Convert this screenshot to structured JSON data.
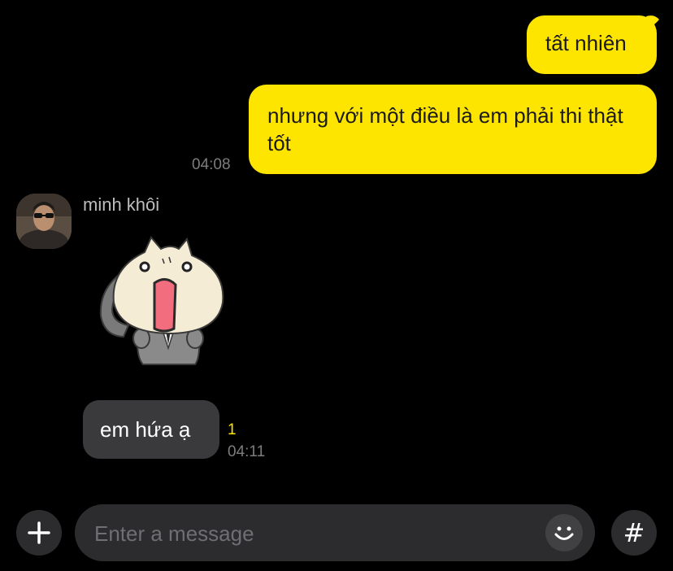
{
  "messages_sent": [
    {
      "text": "tất nhiên"
    },
    {
      "text": "nhưng với một điều là em phải thi thật tốt",
      "time": "04:08"
    }
  ],
  "received": {
    "sender": "minh khôi",
    "sticker": "surprised-cat-sticker",
    "text": "em hứa ạ",
    "unread": "1",
    "time": "04:11"
  },
  "composer": {
    "placeholder": "Enter a message",
    "add_icon": "plus-icon",
    "emoji_icon": "smiley-icon",
    "hashtag_label": "#"
  },
  "colors": {
    "background": "#000000",
    "my_bubble": "#fee500",
    "other_bubble": "#3a3a3c",
    "input_bg": "#2c2c2e"
  }
}
